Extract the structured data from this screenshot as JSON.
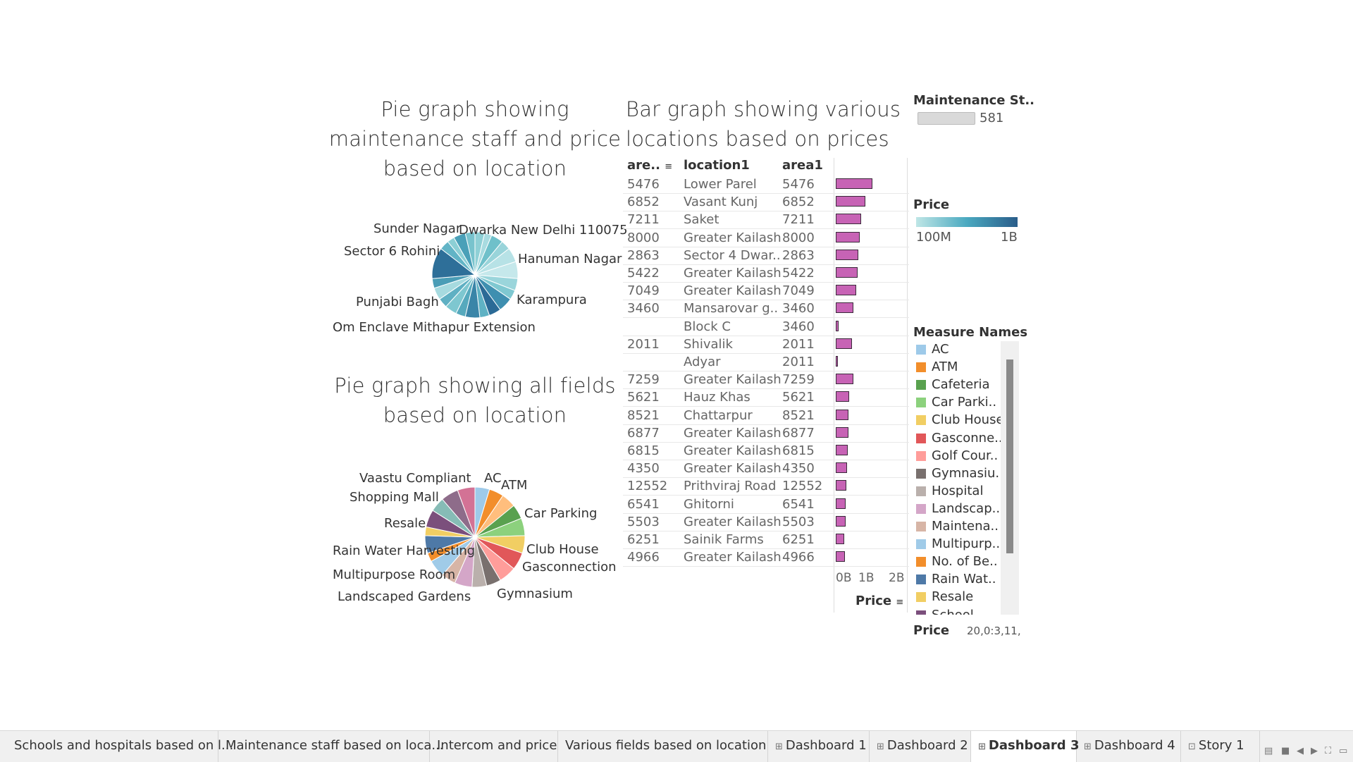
{
  "pie1_title": [
    "Pie graph showing",
    "maintenance staff and price",
    "based on location"
  ],
  "bar_title": [
    "Bar graph showing various",
    "locations based on prices"
  ],
  "pie2_title": [
    "Pie graph showing all fields",
    "based on location"
  ],
  "pie1": {
    "labels": [
      {
        "text": "Sunder Nagar"
      },
      {
        "text": "Dwarka New Delhi 110075"
      },
      {
        "text": "Sector 6 Rohini"
      },
      {
        "text": "Hanuman Nagar"
      },
      {
        "text": "Punjabi Bagh"
      },
      {
        "text": "Karampura"
      },
      {
        "text": "Om Enclave Mithapur Extension"
      }
    ],
    "slices": [
      {
        "v": 4,
        "c": "#8fd0d6"
      },
      {
        "v": 3,
        "c": "#a8dbe0"
      },
      {
        "v": 5,
        "c": "#6fc0ca"
      },
      {
        "v": 4,
        "c": "#99d4da"
      },
      {
        "v": 6,
        "c": "#b7e2e6"
      },
      {
        "v": 7,
        "c": "#c5e8eb"
      },
      {
        "v": 5,
        "c": "#9ad5db"
      },
      {
        "v": 4,
        "c": "#7fc8d1"
      },
      {
        "v": 6,
        "c": "#3f8fb0"
      },
      {
        "v": 5,
        "c": "#2b6a96"
      },
      {
        "v": 4,
        "c": "#5fb2c4"
      },
      {
        "v": 6,
        "c": "#3a85a8"
      },
      {
        "v": 4,
        "c": "#56a9bd"
      },
      {
        "v": 5,
        "c": "#7ec7d0"
      },
      {
        "v": 4,
        "c": "#5fb0c3"
      },
      {
        "v": 5,
        "c": "#a6dadf"
      },
      {
        "v": 4,
        "c": "#4a9db6"
      },
      {
        "v": 13,
        "c": "#2e6f99"
      },
      {
        "v": 4,
        "c": "#62b4c6"
      },
      {
        "v": 3,
        "c": "#8ccfd5"
      },
      {
        "v": 5,
        "c": "#4aa0b8"
      },
      {
        "v": 4,
        "c": "#78c3cd"
      }
    ]
  },
  "table": {
    "headers": [
      "are..",
      "location1",
      "area1"
    ],
    "rows": [
      {
        "a": "5476",
        "loc": "Lower Parel",
        "area": "5476",
        "price": 1.03
      },
      {
        "a": "6852",
        "loc": "Vasant Kunj",
        "area": "6852",
        "price": 0.83
      },
      {
        "a": "7211",
        "loc": "Saket",
        "area": "7211",
        "price": 0.72
      },
      {
        "a": "8000",
        "loc": "Greater Kailash",
        "area": "8000",
        "price": 0.67
      },
      {
        "a": "2863",
        "loc": "Sector 4 Dwar..",
        "area": "2863",
        "price": 0.63
      },
      {
        "a": "5422",
        "loc": "Greater Kailash",
        "area": "5422",
        "price": 0.61
      },
      {
        "a": "7049",
        "loc": "Greater Kailash",
        "area": "7049",
        "price": 0.57
      },
      {
        "a": "3460",
        "loc": "Mansarovar g..",
        "area": "3460",
        "price": 0.49
      },
      {
        "a": "",
        "loc": "Block C",
        "area": "3460",
        "price": 0.08
      },
      {
        "a": "2011",
        "loc": "Shivalik",
        "area": "2011",
        "price": 0.45
      },
      {
        "a": "",
        "loc": "Adyar",
        "area": "2011",
        "price": 0.03
      },
      {
        "a": "7259",
        "loc": "Greater Kailash",
        "area": "7259",
        "price": 0.49
      },
      {
        "a": "5621",
        "loc": "Hauz Khas",
        "area": "5621",
        "price": 0.37
      },
      {
        "a": "8521",
        "loc": "Chattarpur",
        "area": "8521",
        "price": 0.35
      },
      {
        "a": "6877",
        "loc": "Greater Kailash",
        "area": "6877",
        "price": 0.35
      },
      {
        "a": "6815",
        "loc": "Greater Kailash",
        "area": "6815",
        "price": 0.33
      },
      {
        "a": "4350",
        "loc": "Greater Kailash",
        "area": "4350",
        "price": 0.31
      },
      {
        "a": "12552",
        "loc": "Prithviraj Road",
        "area": "12552",
        "price": 0.29
      },
      {
        "a": "6541",
        "loc": "Ghitorni",
        "area": "6541",
        "price": 0.27
      },
      {
        "a": "5503",
        "loc": "Greater Kailash",
        "area": "5503",
        "price": 0.27
      },
      {
        "a": "6251",
        "loc": "Sainik Farms",
        "area": "6251",
        "price": 0.23
      },
      {
        "a": "4966",
        "loc": "Greater Kailash",
        "area": "4966",
        "price": 0.25
      }
    ],
    "axis_ticks": [
      "0B",
      "1B",
      "2B"
    ],
    "axis_max": 2,
    "axis_label": "Price"
  },
  "legend_maint": {
    "title": "Maintenance St..",
    "value": "581"
  },
  "legend_price": {
    "title": "Price",
    "min": "100M",
    "max": "1B",
    "color_low": "#bfe6e6",
    "color_high": "#2a5d8a"
  },
  "legend_measures": {
    "title": "Measure Names",
    "items": [
      {
        "label": "AC",
        "color": "#9ecae9"
      },
      {
        "label": "ATM",
        "color": "#f28e2b"
      },
      {
        "label": "Cafeteria",
        "color": "#59a14f"
      },
      {
        "label": "Car Parki..",
        "color": "#8cd17d"
      },
      {
        "label": "Club House",
        "color": "#f1ce63"
      },
      {
        "label": "Gasconne..",
        "color": "#e15759"
      },
      {
        "label": "Golf Cour..",
        "color": "#ff9d9a"
      },
      {
        "label": "Gymnasiu..",
        "color": "#79706e"
      },
      {
        "label": "Hospital",
        "color": "#bab0ac"
      },
      {
        "label": "Landscap..",
        "color": "#d4a6c8"
      },
      {
        "label": "Maintena..",
        "color": "#d7b5a6"
      },
      {
        "label": "Multipurp..",
        "color": "#a0cbe8"
      },
      {
        "label": "No. of Be..",
        "color": "#f28e2b"
      },
      {
        "label": "Rain Wat..",
        "color": "#4e79a7"
      },
      {
        "label": "Resale",
        "color": "#f1ce63"
      },
      {
        "label": "School",
        "color": "#7b4f7c"
      }
    ]
  },
  "legend_price2": {
    "title": "Price",
    "values": "20,0:3,11,"
  },
  "pie2": {
    "labels": [
      {
        "text": "Vaastu Compliant"
      },
      {
        "text": "AC"
      },
      {
        "text": "ATM"
      },
      {
        "text": "Shopping Mall"
      },
      {
        "text": "Car Parking"
      },
      {
        "text": "Resale"
      },
      {
        "text": "Club House"
      },
      {
        "text": "Rain Water Harvesting"
      },
      {
        "text": "Gasconnection"
      },
      {
        "text": "Multipurpose Room"
      },
      {
        "text": "Gymnasium"
      },
      {
        "text": "Landscaped Gardens"
      }
    ],
    "slices": [
      {
        "v": 5,
        "c": "#9ecae9"
      },
      {
        "v": 5,
        "c": "#f28e2b"
      },
      {
        "v": 5,
        "c": "#ffbe7d"
      },
      {
        "v": 5,
        "c": "#59a14f"
      },
      {
        "v": 6,
        "c": "#8cd17d"
      },
      {
        "v": 6,
        "c": "#f1ce63"
      },
      {
        "v": 6,
        "c": "#e15759"
      },
      {
        "v": 6,
        "c": "#ff9d9a"
      },
      {
        "v": 5,
        "c": "#79706e"
      },
      {
        "v": 5,
        "c": "#bab0ac"
      },
      {
        "v": 6,
        "c": "#d4a6c8"
      },
      {
        "v": 5,
        "c": "#d7b5a6"
      },
      {
        "v": 6,
        "c": "#a0cbe8"
      },
      {
        "v": 3,
        "c": "#f28e2b"
      },
      {
        "v": 6,
        "c": "#4e79a7"
      },
      {
        "v": 3,
        "c": "#f1ce63"
      },
      {
        "v": 6,
        "c": "#7b4f7c"
      },
      {
        "v": 5,
        "c": "#86bcb6"
      },
      {
        "v": 6,
        "c": "#8e6c8a"
      },
      {
        "v": 6,
        "c": "#d37295"
      }
    ]
  },
  "tabs": [
    {
      "label": "Schools and hospitals based on l...",
      "icon": ""
    },
    {
      "label": "Maintenance staff based on loca...",
      "icon": ""
    },
    {
      "label": "Intercom and price",
      "icon": ""
    },
    {
      "label": "Various fields based on location",
      "icon": ""
    },
    {
      "label": "Dashboard 1",
      "icon": "⊞"
    },
    {
      "label": "Dashboard 2",
      "icon": "⊞"
    },
    {
      "label": "Dashboard 3",
      "icon": "⊞"
    },
    {
      "label": "Dashboard 4",
      "icon": "⊞"
    },
    {
      "label": "Story 1",
      "icon": "⊡"
    }
  ],
  "active_tab": 6
}
